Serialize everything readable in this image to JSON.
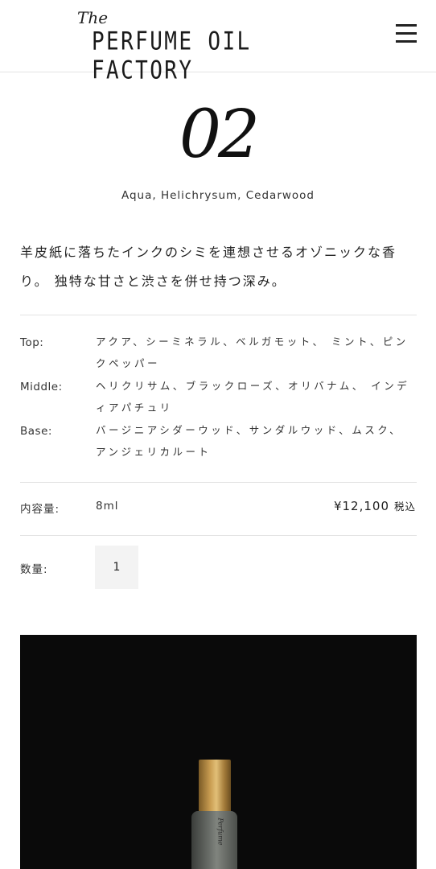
{
  "header": {
    "logo_the": "The",
    "logo_main": "PERFUME OIL FACTORY",
    "menu_icon": "hamburger-menu-icon"
  },
  "product": {
    "number": "02",
    "notes_title": "Aqua, Helichrysum, Cedarwood",
    "description": "羊皮紙に落ちたインクのシミを連想させるオゾニックな香り。 独特な甘さと渋さを併せ持つ深み。",
    "notes": [
      {
        "label": "Top:",
        "value": "アクア、シーミネラル、ベルガモット、 ミント、ピンクペッパー"
      },
      {
        "label": "Middle:",
        "value": "ヘリクリサム、ブラックローズ、オリバナム、 インディアパチュリ"
      },
      {
        "label": "Base:",
        "value": "バージニアシダーウッド、サンダルウッド、ムスク、 アンジェリカルート"
      }
    ],
    "volume_label": "内容量:",
    "volume_value": "8ml",
    "price": "¥12,100",
    "tax_label": "税込",
    "quantity_label": "数量:",
    "quantity_value": "1",
    "bottle_engraving": "Perfume"
  }
}
